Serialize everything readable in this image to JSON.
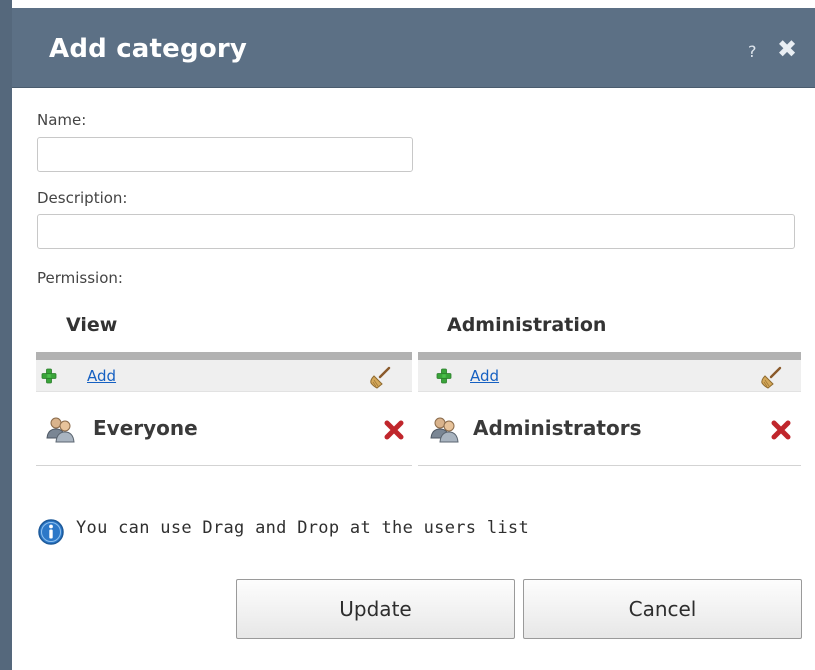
{
  "dialog": {
    "title": "Add category",
    "help_symbol": "?",
    "close_symbol": "✖"
  },
  "form": {
    "name_label": "Name:",
    "name_value": "",
    "description_label": "Description:",
    "description_value": "",
    "permission_label": "Permission:"
  },
  "permissions": {
    "view": {
      "title": "View",
      "add_label": "Add",
      "entries": [
        {
          "label": "Everyone"
        }
      ]
    },
    "administration": {
      "title": "Administration",
      "add_label": "Add",
      "entries": [
        {
          "label": "Administrators"
        }
      ]
    }
  },
  "info": {
    "text": "You can use Drag and Drop at the users list"
  },
  "buttons": {
    "update_label": "Update",
    "cancel_label": "Cancel"
  },
  "icons": {
    "add": "plus-icon",
    "clear": "broom-icon",
    "users": "users-icon",
    "remove": "remove-icon",
    "info": "info-icon"
  },
  "colors": {
    "titlebar": "#5c7085",
    "link": "#1560c2",
    "remove": "#c0262c",
    "add": "#3aa43a",
    "info": "#2c78c8"
  }
}
